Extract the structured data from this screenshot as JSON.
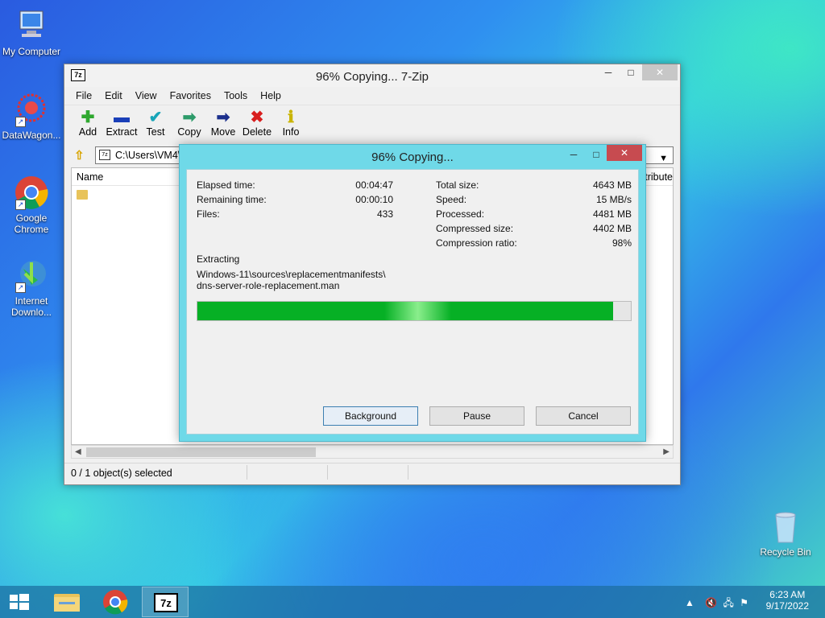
{
  "desktop": {
    "icons": [
      {
        "label": "My Computer",
        "icon": "computer-icon"
      },
      {
        "label": "DataWagon...",
        "icon": "datawagon-icon"
      },
      {
        "label": "Google Chrome",
        "icon": "chrome-icon"
      },
      {
        "label": "Internet Downlo...",
        "icon": "internet-download-manager-icon"
      },
      {
        "label": "Recycle Bin",
        "icon": "recycle-bin-icon"
      }
    ]
  },
  "main_window": {
    "title": "96% Copying... 7-Zip",
    "menu": [
      "File",
      "Edit",
      "View",
      "Favorites",
      "Tools",
      "Help"
    ],
    "toolbar": [
      {
        "label": "Add",
        "icon": "plus-icon",
        "glyph": "✚",
        "color": "#2fa82f"
      },
      {
        "label": "Extract",
        "icon": "minus-icon",
        "glyph": "▬",
        "color": "#1a3fb8"
      },
      {
        "label": "Test",
        "icon": "check-icon",
        "glyph": "✔",
        "color": "#18a5b8"
      },
      {
        "label": "Copy",
        "icon": "copy-arrow-icon",
        "glyph": "➡",
        "color": "#2d9b6a"
      },
      {
        "label": "Move",
        "icon": "move-arrow-icon",
        "glyph": "➡",
        "color": "#1b2f8c"
      },
      {
        "label": "Delete",
        "icon": "delete-x-icon",
        "glyph": "✖",
        "color": "#d81e1e"
      },
      {
        "label": "Info",
        "icon": "info-icon",
        "glyph": "ℹ",
        "color": "#c9b400"
      }
    ],
    "address": "C:\\Users\\VM4\\",
    "list": {
      "name_header": "Name",
      "attr_header": "ttribute"
    },
    "status": "0 / 1 object(s) selected"
  },
  "dialog": {
    "title": "96% Copying...",
    "left_stats": [
      {
        "label": "Elapsed time:",
        "value": "00:04:47"
      },
      {
        "label": "Remaining time:",
        "value": "00:00:10"
      },
      {
        "label": "Files:",
        "value": "433"
      }
    ],
    "right_stats": [
      {
        "label": "Total size:",
        "value": "4643 MB"
      },
      {
        "label": "Speed:",
        "value": "15 MB/s"
      },
      {
        "label": "Processed:",
        "value": "4481 MB"
      },
      {
        "label": "Compressed size:",
        "value": "4402 MB"
      },
      {
        "label": "Compression ratio:",
        "value": "98%"
      }
    ],
    "operation": "Extracting",
    "path_line1": "Windows-11\\sources\\replacementmanifests\\",
    "path_line2": "dns-server-role-replacement.man",
    "progress_percent": 96,
    "buttons": {
      "background": "Background",
      "pause": "Pause",
      "cancel": "Cancel"
    }
  },
  "taskbar": {
    "time": "6:23 AM",
    "date": "9/17/2022"
  }
}
